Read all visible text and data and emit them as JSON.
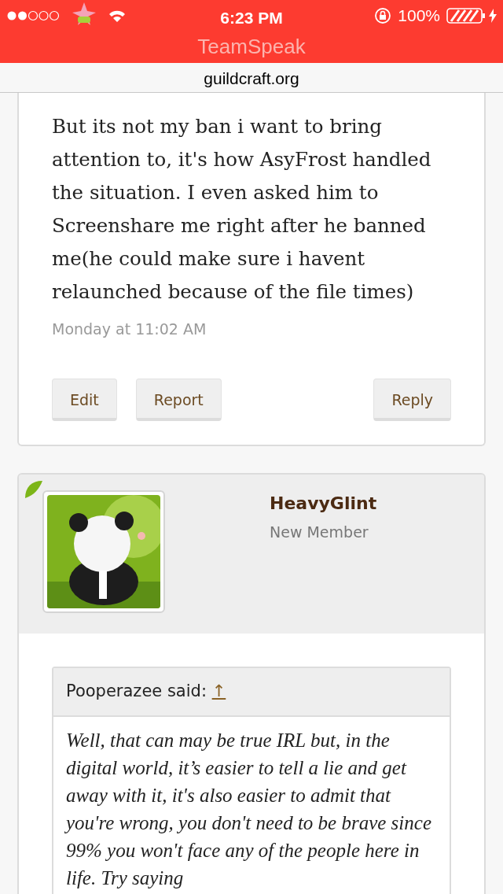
{
  "status_bar": {
    "time": "6:23 PM",
    "battery": "100%",
    "app": "TeamSpeak"
  },
  "address_bar": {
    "url": "guildcraft.org"
  },
  "posts": [
    {
      "text": "But its not my ban i want to bring attention to, it's how AsyFrost handled the situation. I even asked him to Screenshare me right after he banned me(he could make sure i havent relaunched because of the file times)",
      "timestamp": "Monday at 11:02 AM",
      "actions": [
        "Edit",
        "Report"
      ],
      "reply_button": "Reply"
    },
    {
      "author": "HeavyGlint",
      "role": "New Member",
      "quote": {
        "author": "Pooperazee said:",
        "arrow": "↑",
        "text": "Well, that can may be true IRL but, in the digital world, it’s easier to tell a lie and get away with it, it's also easier to admit that you're wrong, you don't need to be brave since 99% you won't face any of the people here in life. Try saying"
      }
    }
  ]
}
